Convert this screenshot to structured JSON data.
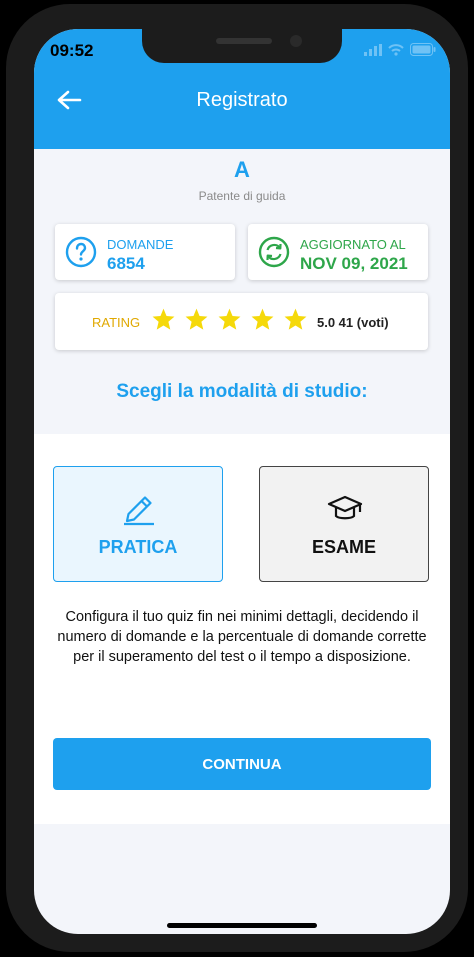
{
  "status_bar": {
    "time": "09:52"
  },
  "header": {
    "title": "Registrato",
    "back_icon": "back-arrow-icon"
  },
  "license": {
    "letter": "A",
    "subtitle": "Patente di guida"
  },
  "stats": {
    "questions": {
      "label": "DOMANDE",
      "value": "6854",
      "icon": "question-circle-icon"
    },
    "updated": {
      "label": "AGGIORNATO AL",
      "value": "NOV 09, 2021",
      "icon": "refresh-circle-icon"
    }
  },
  "rating": {
    "label": "RATING",
    "stars": 5,
    "max_stars": 5,
    "text": "5.0 41 (voti)"
  },
  "study": {
    "title": "Scegli la modalità di studio:",
    "modes": [
      {
        "label": "PRATICA",
        "icon": "pencil-icon",
        "selected": true
      },
      {
        "label": "ESAME",
        "icon": "graduation-cap-icon",
        "selected": false
      }
    ],
    "description": "Configura il tuo quiz fin nei minimi dettagli, decidendo il numero di domande e la percentuale di domande corrette  per il superamento del test o il tempo a disposizione."
  },
  "continue_button": {
    "label": "CONTINUA"
  },
  "colors": {
    "accent": "#1ea0ee",
    "star": "#f5d90a",
    "rating_label": "#e0a800"
  }
}
